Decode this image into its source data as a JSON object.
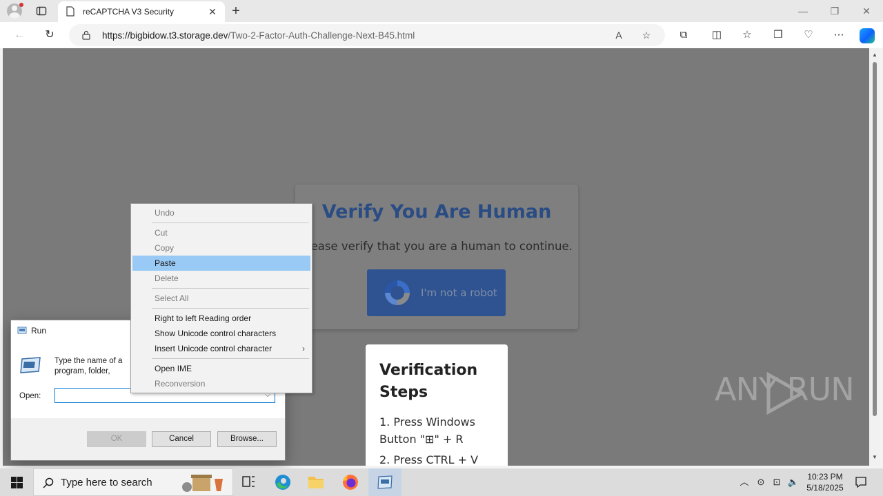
{
  "browser": {
    "tab_title": "reCAPTCHA V3 Security",
    "tab_close": "✕",
    "new_tab": "+",
    "url_host": "https://bigbidow.t3.storage.dev",
    "url_path": "/Two-2-Factor-Auth-Challenge-Next-B45.html",
    "window_controls": {
      "minimize": "—",
      "restore": "❐",
      "close": "✕"
    }
  },
  "page": {
    "captcha_title": "Verify You Are Human",
    "captcha_text": "Please verify that you are a human to continue.",
    "robot_button": "I'm not a robot",
    "steps_title": "Verification Steps",
    "step1": "1. Press Windows Button \"⊞\" + R",
    "step2": "2. Press CTRL + V",
    "watermark": "ANY    RUN"
  },
  "run_dialog": {
    "title": "Run",
    "description": "Type the name of a program, folder, document, or Internet resource, and Windows will open it for you.",
    "open_label": "Open:",
    "open_value": "",
    "ok": "OK",
    "cancel": "Cancel",
    "browse": "Browse..."
  },
  "context_menu": {
    "undo": "Undo",
    "cut": "Cut",
    "copy": "Copy",
    "paste": "Paste",
    "delete": "Delete",
    "select_all": "Select All",
    "rtl": "Right to left Reading order",
    "show_unicode": "Show Unicode control characters",
    "insert_unicode": "Insert Unicode control character",
    "open_ime": "Open IME",
    "reconversion": "Reconversion"
  },
  "taskbar": {
    "search_placeholder": "Type here to search",
    "time": "10:23 PM",
    "date": "5/18/2025"
  },
  "colors": {
    "captcha_title": "#2a4c84",
    "robot_button": "#2f5390",
    "menu_highlight": "#99c9f5",
    "page_overlay": "#7a7a7a"
  }
}
